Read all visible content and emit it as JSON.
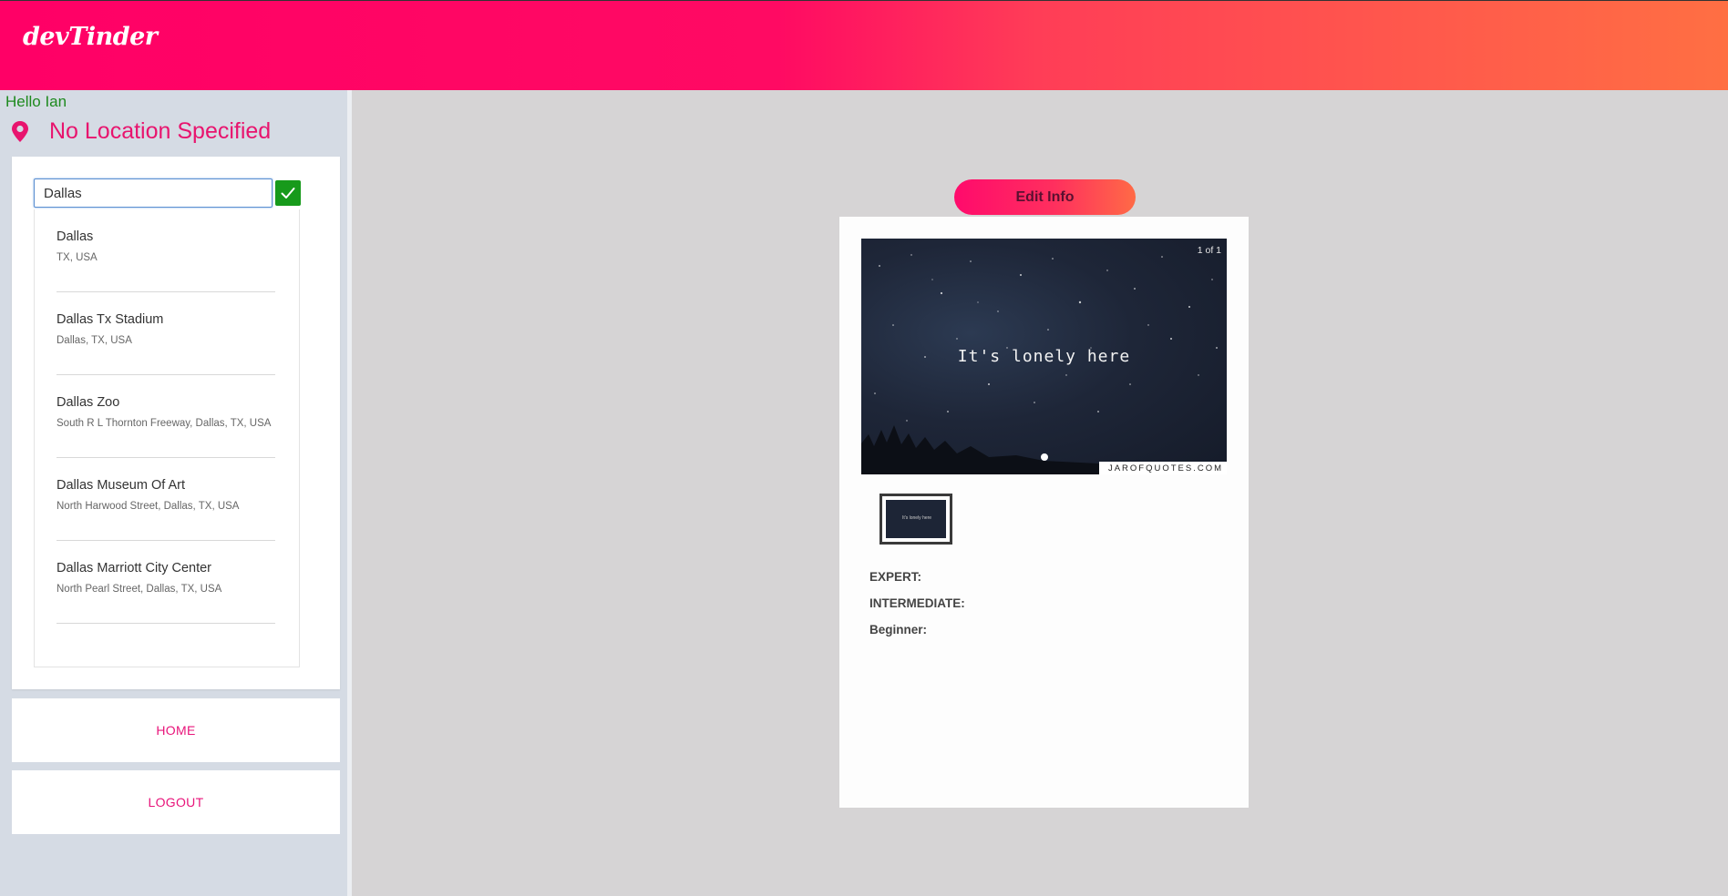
{
  "app": {
    "logo": "devTinder"
  },
  "sidebar": {
    "greeting": "Hello Ian",
    "location_text": "No Location Specified",
    "search": {
      "value": "Dallas",
      "placeholder": ""
    },
    "suggestions": [
      {
        "title": "Dallas",
        "subtitle": "TX, USA"
      },
      {
        "title": "Dallas Tx Stadium",
        "subtitle": "Dallas, TX, USA"
      },
      {
        "title": "Dallas Zoo",
        "subtitle": "South R L Thornton Freeway, Dallas, TX, USA"
      },
      {
        "title": "Dallas Museum Of Art",
        "subtitle": "North Harwood Street, Dallas, TX, USA"
      },
      {
        "title": "Dallas Marriott City Center",
        "subtitle": "North Pearl Street, Dallas, TX, USA"
      }
    ],
    "home_label": "HOME",
    "logout_label": "LOGOUT"
  },
  "profile": {
    "edit_label": "Edit Info",
    "photo_counter": "1 of 1",
    "photo_caption": "It's lonely here",
    "photo_credit": "JAROFQUOTES.COM",
    "thumb_caption": "It's lonely here",
    "skills": {
      "expert": "EXPERT:",
      "intermediate": "INTERMEDIATE:",
      "beginner": "Beginner:"
    }
  },
  "colors": {
    "brand_pink": "#ff0066",
    "brand_orange": "#ff6f43",
    "accent_text": "#e8146e",
    "success_green": "#179a1b"
  }
}
